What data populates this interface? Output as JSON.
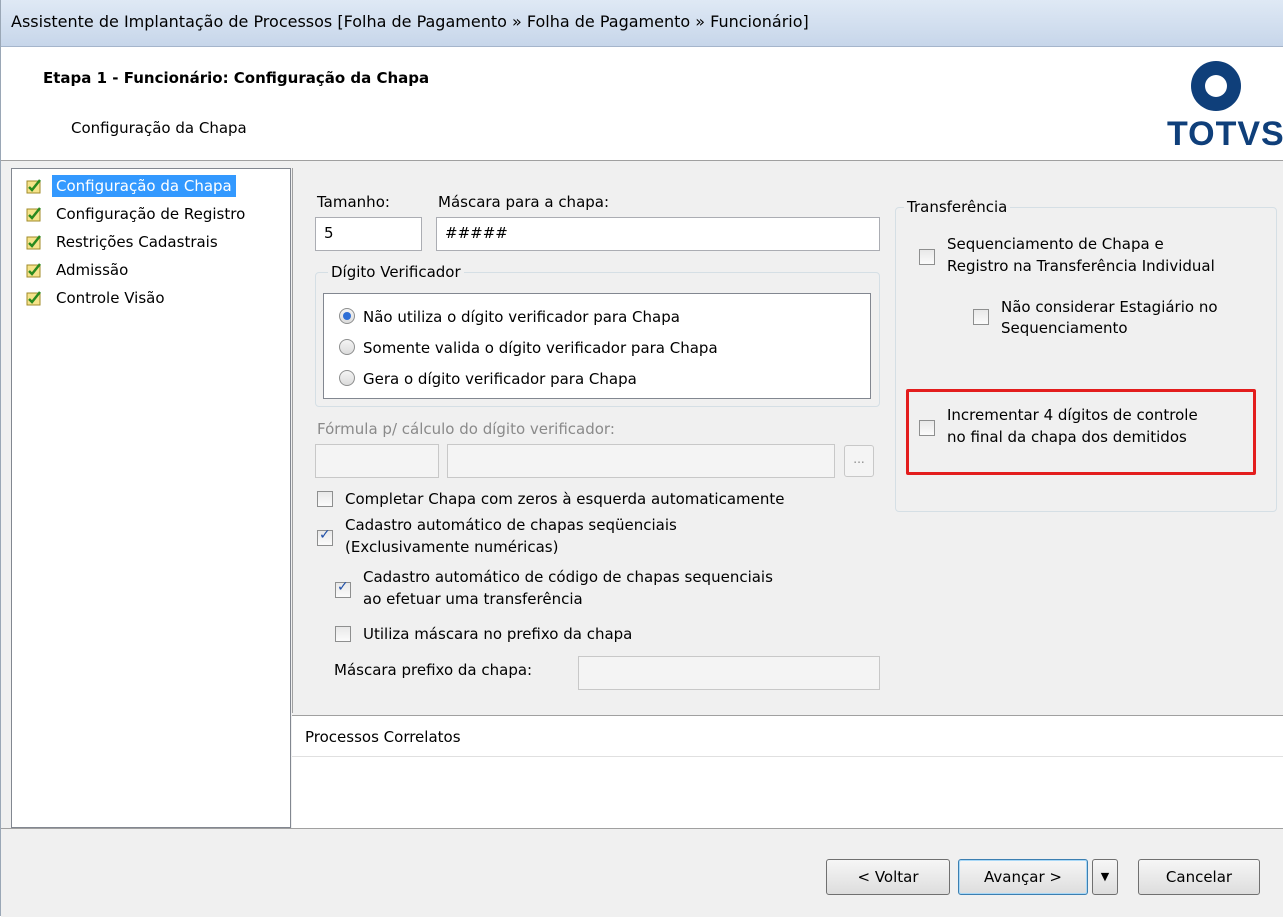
{
  "window": {
    "title": "Assistente de Implantação de Processos [Folha de Pagamento » Folha de Pagamento » Funcionário]"
  },
  "header": {
    "step_title": "Etapa 1 - Funcionário: Configuração da Chapa",
    "step_subtitle": "Configuração da Chapa",
    "logo_text": "TOTVS",
    "brand_color": "#0f3f7a"
  },
  "steps": [
    {
      "label": "Configuração da Chapa",
      "selected": true
    },
    {
      "label": "Configuração de Registro",
      "selected": false
    },
    {
      "label": "Restrições Cadastrais",
      "selected": false
    },
    {
      "label": "Admissão",
      "selected": false
    },
    {
      "label": "Controle Visão",
      "selected": false
    }
  ],
  "form": {
    "tamanho_label": "Tamanho:",
    "tamanho_value": "5",
    "mascara_label": "Máscara para a chapa:",
    "mascara_value": "#####",
    "digito_legend": "Dígito Verificador",
    "digito_options": [
      {
        "label": "Não utiliza o dígito verificador para Chapa",
        "checked": true
      },
      {
        "label": "Somente valida o dígito verificador para Chapa",
        "checked": false
      },
      {
        "label": "Gera o dígito verificador para Chapa",
        "checked": false
      }
    ],
    "formula_label": "Fórmula p/ cálculo do dígito verificador:",
    "formula_code": "",
    "formula_desc": "",
    "browse_label": "...",
    "completar_label": "Completar Chapa com zeros à esquerda automaticamente",
    "completar_checked": false,
    "cadastro_line1": "Cadastro automático de chapas seqüenciais",
    "cadastro_line2": "(Exclusivamente numéricas)",
    "cadastro_checked": true,
    "cadastro_transf_line1": "Cadastro automático de código de chapas sequenciais",
    "cadastro_transf_line2": "ao efetuar uma transferência",
    "cadastro_transf_checked": true,
    "utiliza_mascara_label": "Utiliza máscara no prefixo da chapa",
    "utiliza_mascara_checked": false,
    "mascara_prefixo_label": "Máscara prefixo da chapa:",
    "mascara_prefixo_value": ""
  },
  "transferencia": {
    "legend": "Transferência",
    "seq_line1": "Sequenciamento de Chapa e",
    "seq_line2": "Registro na Transferência Individual",
    "seq_checked": false,
    "estag_line1": "Não considerar Estagiário no",
    "estag_line2": "Sequenciamento",
    "estag_checked": false,
    "incr_line1": "Incrementar 4 dígitos de controle",
    "incr_line2": "no final da chapa dos demitidos",
    "incr_checked": false,
    "highlight_color": "#e31d1d"
  },
  "correlatos": {
    "title": "Processos Correlatos"
  },
  "footer": {
    "voltar": "< Voltar",
    "avancar": "Avançar >",
    "dropdown_icon": "▼",
    "cancelar": "Cancelar"
  }
}
